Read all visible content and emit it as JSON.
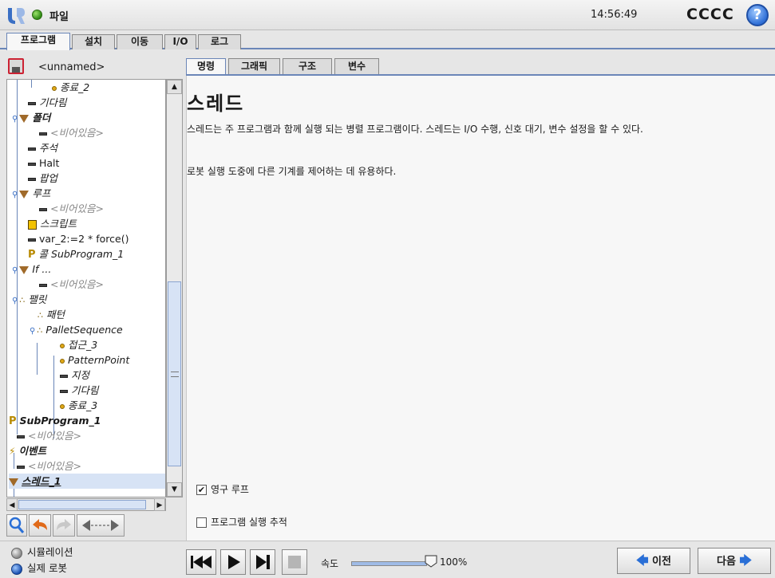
{
  "header": {
    "file_menu": "파일",
    "clock": "14:56:49",
    "robot_name": "CCCC",
    "help": "?"
  },
  "main_tabs": [
    "프로그램",
    "설치",
    "이동",
    "I/O",
    "로그"
  ],
  "program_name": "<unnamed>",
  "tree": [
    {
      "label": "종료_2",
      "icon": "waypoint"
    },
    {
      "label": "기다림",
      "icon": "dash"
    },
    {
      "label": "폴더",
      "icon": "folder"
    },
    {
      "label": "<비어있음>",
      "icon": "dash"
    },
    {
      "label": "주석",
      "icon": "dash"
    },
    {
      "label": "Halt",
      "icon": "dash"
    },
    {
      "label": "팝업",
      "icon": "dash"
    },
    {
      "label": "루프",
      "icon": "folder"
    },
    {
      "label": "<비어있음>",
      "icon": "dash"
    },
    {
      "label": "스크립트",
      "icon": "script"
    },
    {
      "label": "var_2:=2 * force()",
      "icon": "dash"
    },
    {
      "label": "콜 SubProgram_1",
      "icon": "subprogram"
    },
    {
      "label": "If ...",
      "icon": "folder"
    },
    {
      "label": "<비어있음>",
      "icon": "dash"
    },
    {
      "label": "팰릿",
      "icon": "pallet"
    },
    {
      "label": "패턴",
      "icon": "pallet"
    },
    {
      "label": "PalletSequence",
      "icon": "pallet"
    },
    {
      "label": "접근_3",
      "icon": "waypoint"
    },
    {
      "label": "PatternPoint",
      "icon": "waypoint"
    },
    {
      "label": "지정",
      "icon": "dash"
    },
    {
      "label": "기다림",
      "icon": "dash"
    },
    {
      "label": "종료_3",
      "icon": "waypoint"
    },
    {
      "label": "SubProgram_1",
      "icon": "subprogram"
    },
    {
      "label": "<비어있음>",
      "icon": "dash"
    },
    {
      "label": "이벤트",
      "icon": "event"
    },
    {
      "label": "<비어있음>",
      "icon": "dash"
    },
    {
      "label": "스레드_1",
      "icon": "folder"
    }
  ],
  "content_tabs": [
    "명령",
    "그래픽",
    "구조",
    "변수"
  ],
  "content": {
    "title": "스레드",
    "desc1": "스레드는 주 프로그램과 함께 실행 되는 병렬 프로그램이다. 스레드는 I/O 수행, 신호 대기, 변수 설정을 할 수 있다.",
    "desc2": "로봇 실행 도중에 다른 기계를 제어하는 데 유용하다.",
    "checkbox_loop": "영구 루프",
    "checkbox_trace": "프로그램 실행 추적",
    "loop_checked": true,
    "trace_checked": false
  },
  "footer": {
    "simulation": "시뮬레이션",
    "real_robot": "실제 로봇",
    "speed_label": "속도",
    "speed_value": "100%",
    "speed_fraction": 1.0,
    "prev": "이전",
    "next": "다음"
  },
  "colors": {
    "accent": "#6b86b8",
    "tab_border": "#6b86b8",
    "waypoint": "#e0a817"
  }
}
